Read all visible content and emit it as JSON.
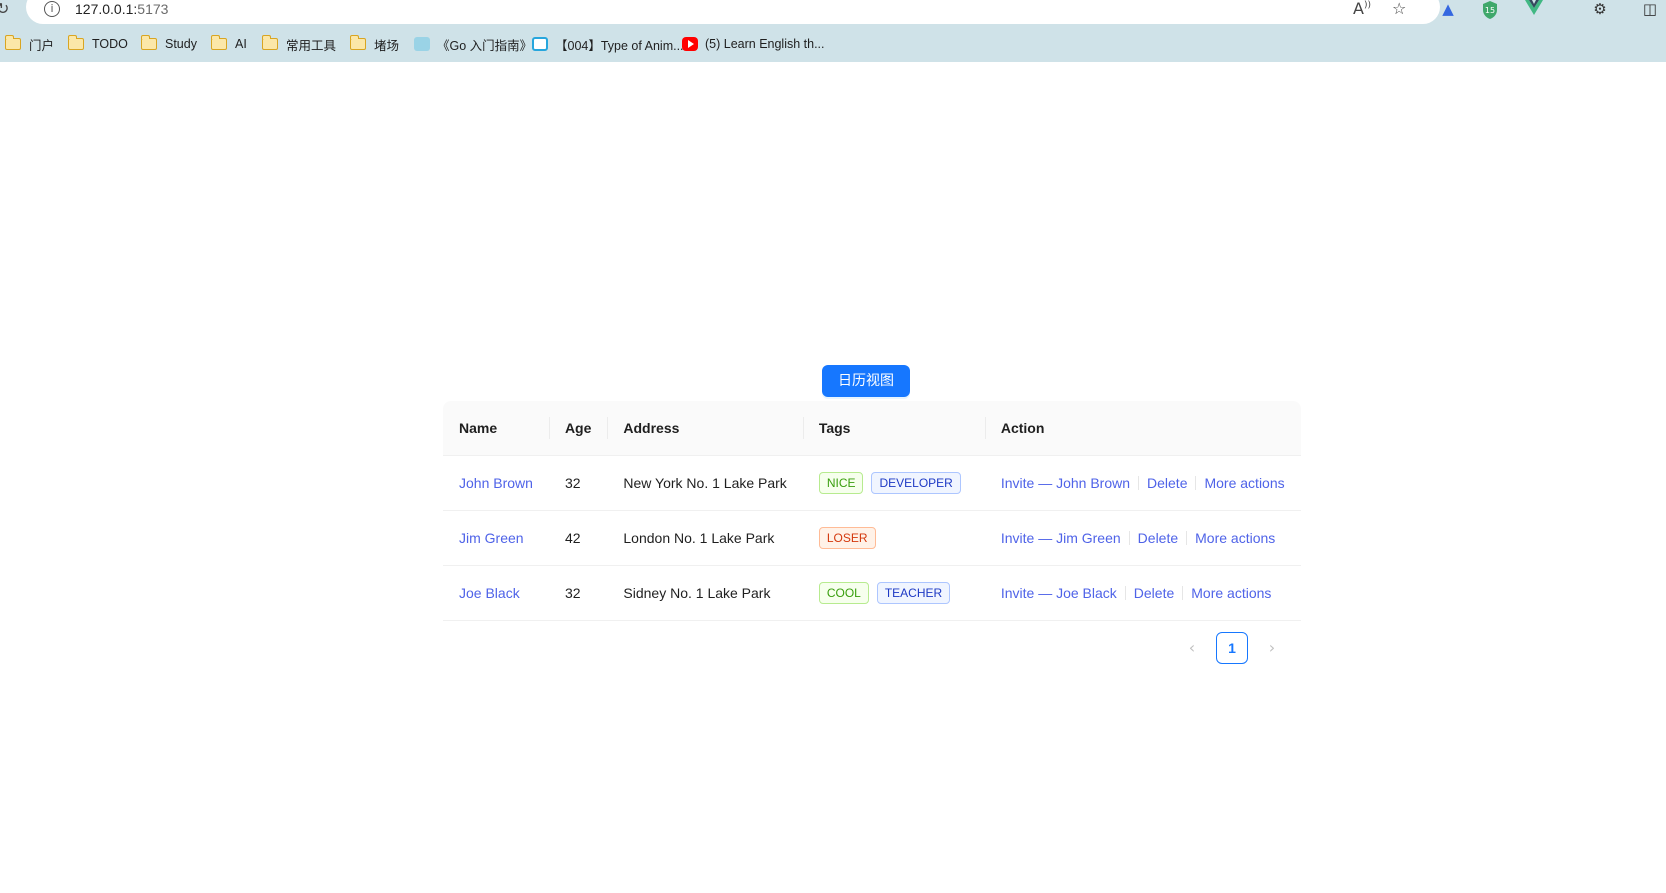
{
  "browser": {
    "url_host": "127.0.0.1:",
    "url_port": "5173",
    "bookmarks": [
      {
        "label": "门户",
        "icon": "folder-icon"
      },
      {
        "label": "TODO",
        "icon": "folder-icon"
      },
      {
        "label": "Study",
        "icon": "folder-icon"
      },
      {
        "label": "AI",
        "icon": "folder-icon"
      },
      {
        "label": "常用工具",
        "icon": "folder-icon"
      },
      {
        "label": "堵场",
        "icon": "folder-icon"
      },
      {
        "label": "《Go 入门指南》",
        "icon": "page-favicon"
      },
      {
        "label": "【004】Type of Anim...",
        "icon": "bilibili-icon"
      },
      {
        "label": "(5) Learn English th...",
        "icon": "youtube-icon"
      }
    ],
    "extension_badge": "15"
  },
  "page": {
    "calendar_button": "日历视图"
  },
  "table": {
    "columns": [
      "Name",
      "Age",
      "Address",
      "Tags",
      "Action"
    ],
    "rows": [
      {
        "name": "John Brown",
        "age": "32",
        "address": "New York No. 1 Lake Park",
        "tags": [
          {
            "label": "NICE",
            "color": "green"
          },
          {
            "label": "DEVELOPER",
            "color": "geekblue"
          }
        ],
        "invite": "Invite — John Brown",
        "delete": "Delete",
        "more": "More actions"
      },
      {
        "name": "Jim Green",
        "age": "42",
        "address": "London No. 1 Lake Park",
        "tags": [
          {
            "label": "LOSER",
            "color": "volcano"
          }
        ],
        "invite": "Invite — Jim Green",
        "delete": "Delete",
        "more": "More actions"
      },
      {
        "name": "Joe Black",
        "age": "32",
        "address": "Sidney No. 1 Lake Park",
        "tags": [
          {
            "label": "COOL",
            "color": "green"
          },
          {
            "label": "TEACHER",
            "color": "geekblue"
          }
        ],
        "invite": "Invite — Joe Black",
        "delete": "Delete",
        "more": "More actions"
      }
    ]
  },
  "pagination": {
    "current_page": "1",
    "prev_icon": "chevron-left-icon",
    "next_icon": "chevron-right-icon"
  },
  "colors": {
    "primary": "#1677ff",
    "link": "#4f63e8",
    "chrome_bg": "#cfe2e8"
  }
}
